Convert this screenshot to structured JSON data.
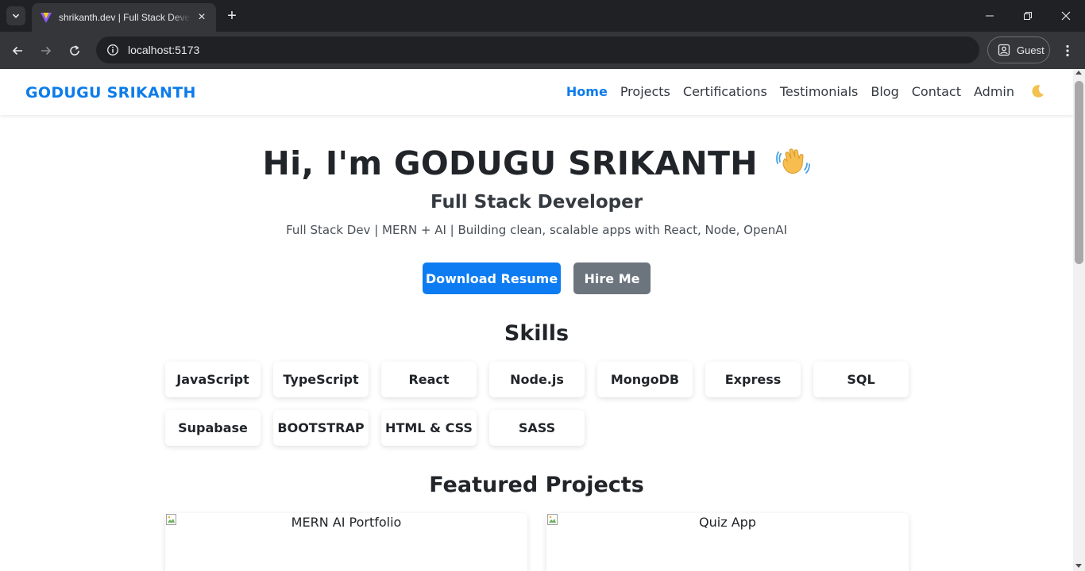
{
  "browser": {
    "tab_title": "shrikanth.dev | Full Stack Developer",
    "url": "localhost:5173",
    "profile_label": "Guest"
  },
  "site": {
    "brand": "GODUGU SRIKANTH",
    "nav": [
      {
        "label": "Home",
        "active": true
      },
      {
        "label": "Projects"
      },
      {
        "label": "Certifications"
      },
      {
        "label": "Testimonials"
      },
      {
        "label": "Blog"
      },
      {
        "label": "Contact"
      },
      {
        "label": "Admin"
      }
    ],
    "theme_toggle_icon": "moon-icon"
  },
  "hero": {
    "title": "Hi, I'm GODUGU SRIKANTH",
    "title_icon": "waving-hand-icon",
    "subtitle": "Full Stack Developer",
    "tagline": "Full Stack Dev | MERN + AI | Building clean, scalable apps with React, Node, OpenAI",
    "primary_button": "Download Resume",
    "secondary_button": "Hire Me"
  },
  "skills": {
    "title": "Skills",
    "items": [
      "JavaScript",
      "TypeScript",
      "React",
      "Node.js",
      "MongoDB",
      "Express",
      "SQL",
      "Supabase",
      "BOOTSTRAP",
      "HTML & CSS",
      "SASS"
    ]
  },
  "projects": {
    "title": "Featured Projects",
    "items": [
      {
        "image_alt": "MERN AI Portfolio"
      },
      {
        "image_alt": "Quiz App"
      }
    ]
  },
  "colors": {
    "accent": "#0d7cf2",
    "secondary_button": "#6c757d",
    "chrome_dark": "#202124",
    "chrome_toolbar": "#35363a"
  }
}
